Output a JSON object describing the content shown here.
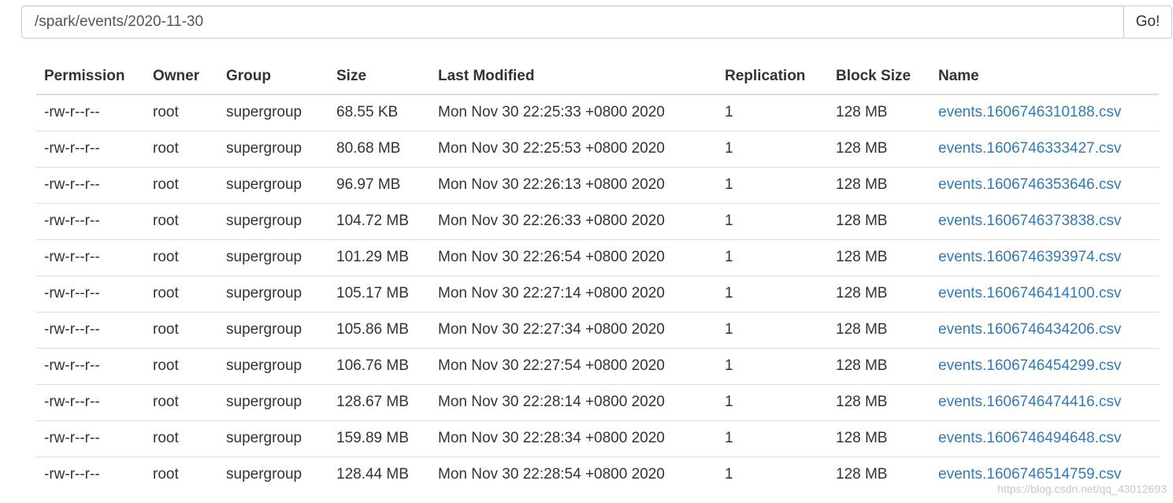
{
  "path_bar": {
    "value": "/spark/events/2020-11-30",
    "go_label": "Go!"
  },
  "table": {
    "columns": [
      "Permission",
      "Owner",
      "Group",
      "Size",
      "Last Modified",
      "Replication",
      "Block Size",
      "Name"
    ],
    "rows": [
      [
        "-rw-r--r--",
        "root",
        "supergroup",
        "68.55 KB",
        "Mon Nov 30 22:25:33 +0800 2020",
        "1",
        "128 MB",
        "events.1606746310188.csv"
      ],
      [
        "-rw-r--r--",
        "root",
        "supergroup",
        "80.68 MB",
        "Mon Nov 30 22:25:53 +0800 2020",
        "1",
        "128 MB",
        "events.1606746333427.csv"
      ],
      [
        "-rw-r--r--",
        "root",
        "supergroup",
        "96.97 MB",
        "Mon Nov 30 22:26:13 +0800 2020",
        "1",
        "128 MB",
        "events.1606746353646.csv"
      ],
      [
        "-rw-r--r--",
        "root",
        "supergroup",
        "104.72 MB",
        "Mon Nov 30 22:26:33 +0800 2020",
        "1",
        "128 MB",
        "events.1606746373838.csv"
      ],
      [
        "-rw-r--r--",
        "root",
        "supergroup",
        "101.29 MB",
        "Mon Nov 30 22:26:54 +0800 2020",
        "1",
        "128 MB",
        "events.1606746393974.csv"
      ],
      [
        "-rw-r--r--",
        "root",
        "supergroup",
        "105.17 MB",
        "Mon Nov 30 22:27:14 +0800 2020",
        "1",
        "128 MB",
        "events.1606746414100.csv"
      ],
      [
        "-rw-r--r--",
        "root",
        "supergroup",
        "105.86 MB",
        "Mon Nov 30 22:27:34 +0800 2020",
        "1",
        "128 MB",
        "events.1606746434206.csv"
      ],
      [
        "-rw-r--r--",
        "root",
        "supergroup",
        "106.76 MB",
        "Mon Nov 30 22:27:54 +0800 2020",
        "1",
        "128 MB",
        "events.1606746454299.csv"
      ],
      [
        "-rw-r--r--",
        "root",
        "supergroup",
        "128.67 MB",
        "Mon Nov 30 22:28:14 +0800 2020",
        "1",
        "128 MB",
        "events.1606746474416.csv"
      ],
      [
        "-rw-r--r--",
        "root",
        "supergroup",
        "159.89 MB",
        "Mon Nov 30 22:28:34 +0800 2020",
        "1",
        "128 MB",
        "events.1606746494648.csv"
      ],
      [
        "-rw-r--r--",
        "root",
        "supergroup",
        "128.44 MB",
        "Mon Nov 30 22:28:54 +0800 2020",
        "1",
        "128 MB",
        "events.1606746514759.csv"
      ]
    ]
  },
  "watermark": "https://blog.csdn.net/qq_43012693",
  "colors": {
    "link": "#337ab7",
    "text": "#333333",
    "border": "#dddddd"
  }
}
